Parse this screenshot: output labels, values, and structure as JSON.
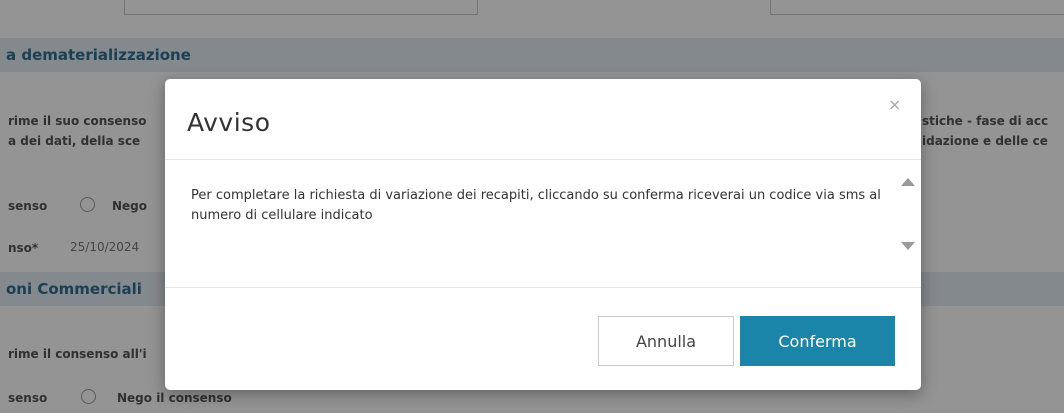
{
  "background": {
    "section1_title": "a dematerializzazione",
    "consent_text_left_1": "rime il suo consenso",
    "consent_text_left_2": "a dei dati, della sce",
    "consent_text_right_1": "stiche - fase di acc",
    "consent_text_right_2": "idazione e delle ce",
    "consent_label": "senso",
    "nego_label_short": "Nego",
    "date_label": "nso*",
    "date_value": "25/10/2024",
    "section2_title": "oni Commerciali",
    "consent_text_left_3": "rime il consenso all'i",
    "consent_label_2": "senso",
    "nego_label_full": "Nego il consenso"
  },
  "modal": {
    "title": "Avviso",
    "close_symbol": "×",
    "message": "Per completare la richiesta di variazione dei recapiti, cliccando su conferma riceverai un codice via sms al numero di cellulare indicato",
    "cancel_label": "Annulla",
    "confirm_label": "Conferma"
  },
  "colors": {
    "confirm_bg": "#1a84a9",
    "section_bg": "#e4edf3",
    "section_title": "#2f6e93"
  }
}
